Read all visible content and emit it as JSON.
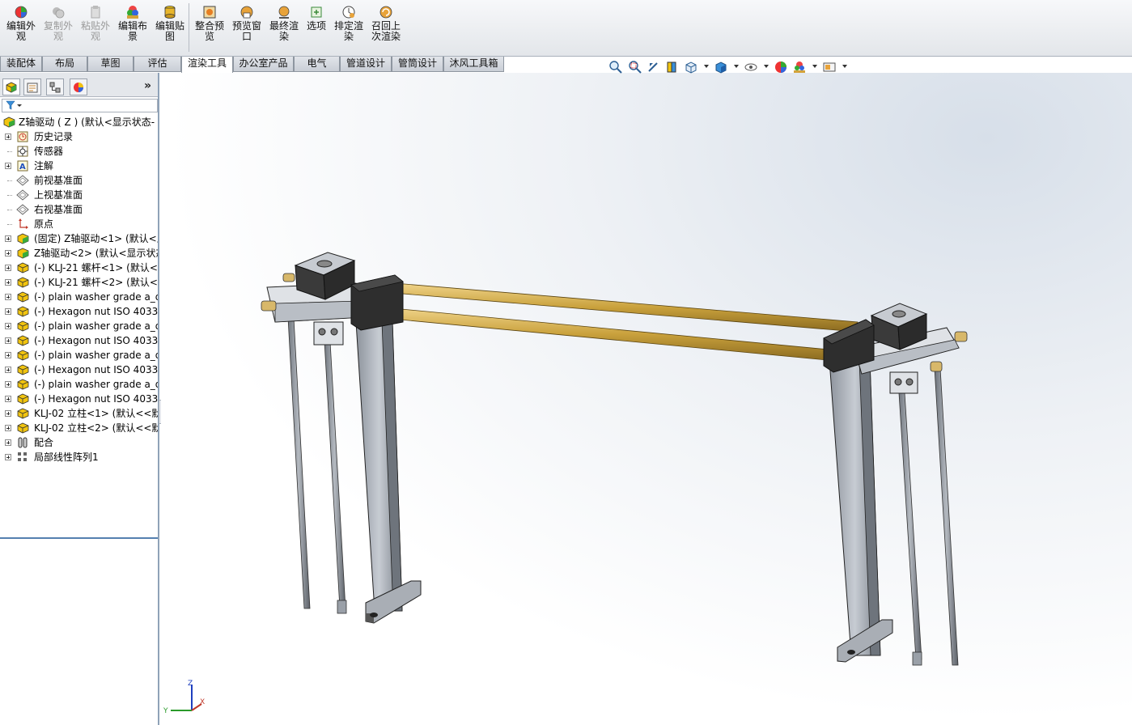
{
  "ribbon": {
    "buttons": [
      {
        "label_line1": "编辑外",
        "label_line2": "观",
        "enabled": true,
        "icon": "edit-appearance-icon"
      },
      {
        "label_line1": "复制外",
        "label_line2": "观",
        "enabled": false,
        "icon": "copy-appearance-icon"
      },
      {
        "label_line1": "粘贴外",
        "label_line2": "观",
        "enabled": false,
        "icon": "paste-appearance-icon"
      },
      {
        "label_line1": "编辑布",
        "label_line2": "景",
        "enabled": true,
        "icon": "edit-scene-icon"
      },
      {
        "label_line1": "编辑贴",
        "label_line2": "图",
        "enabled": true,
        "icon": "edit-decal-icon"
      },
      {
        "label_line1": "整合预",
        "label_line2": "览",
        "enabled": true,
        "icon": "integrated-preview-icon"
      },
      {
        "label_line1": "预览窗",
        "label_line2": "口",
        "enabled": true,
        "icon": "preview-window-icon"
      },
      {
        "label_line1": "最终渲",
        "label_line2": "染",
        "enabled": true,
        "icon": "final-render-icon"
      },
      {
        "label_line1": "选项",
        "label_line2": "",
        "enabled": true,
        "icon": "options-icon"
      },
      {
        "label_line1": "排定渲",
        "label_line2": "染",
        "enabled": true,
        "icon": "schedule-render-icon"
      },
      {
        "label_line1": "召回上",
        "label_line2": "次渲染",
        "enabled": true,
        "icon": "recall-render-icon"
      }
    ]
  },
  "tabs": [
    "装配体",
    "布局",
    "草图",
    "评估",
    "渲染工具",
    "办公室产品",
    "电气",
    "管道设计",
    "管筒设计",
    "沐风工具箱"
  ],
  "active_tab": "渲染工具",
  "panel": {
    "expand_label": "»"
  },
  "tree": {
    "root": "Z轴驱动 ( Z )   (默认<显示状态-",
    "items": [
      {
        "label": "历史记录",
        "icon": "history-icon",
        "expandable": true
      },
      {
        "label": "传感器",
        "icon": "sensor-icon",
        "expandable": false
      },
      {
        "label": "注解",
        "icon": "annotation-icon",
        "expandable": true
      },
      {
        "label": "前视基准面",
        "icon": "plane-icon",
        "expandable": false
      },
      {
        "label": "上视基准面",
        "icon": "plane-icon",
        "expandable": false
      },
      {
        "label": "右视基准面",
        "icon": "plane-icon",
        "expandable": false
      },
      {
        "label": "原点",
        "icon": "origin-icon",
        "expandable": false
      },
      {
        "label": "(固定) Z轴驱动<1> (默认<显",
        "icon": "subassembly-icon",
        "expandable": true
      },
      {
        "label": "Z轴驱动<2> (默认<显示状态",
        "icon": "subassembly-icon",
        "expandable": true
      },
      {
        "label": "(-) KLJ-21 螺杆<1> (默认<<",
        "icon": "part-icon",
        "expandable": true
      },
      {
        "label": "(-) KLJ-21 螺杆<2> (默认<<",
        "icon": "part-icon",
        "expandable": true
      },
      {
        "label": "(-) plain washer grade a_d",
        "icon": "part-icon",
        "expandable": true
      },
      {
        "label": "(-) Hexagon nut ISO 4033",
        "icon": "part-icon",
        "expandable": true
      },
      {
        "label": "(-) plain washer grade a_d",
        "icon": "part-icon",
        "expandable": true
      },
      {
        "label": "(-) Hexagon nut ISO 4033",
        "icon": "part-icon",
        "expandable": true
      },
      {
        "label": "(-) plain washer grade a_d",
        "icon": "part-icon",
        "expandable": true
      },
      {
        "label": "(-) Hexagon nut ISO 4033",
        "icon": "part-icon",
        "expandable": true
      },
      {
        "label": "(-) plain washer grade a_d",
        "icon": "part-icon",
        "expandable": true
      },
      {
        "label": "(-) Hexagon nut ISO 4033",
        "icon": "part-icon",
        "expandable": true
      },
      {
        "label": "KLJ-02 立柱<1> (默认<<默",
        "icon": "part-icon",
        "expandable": true
      },
      {
        "label": "KLJ-02 立柱<2> (默认<<默",
        "icon": "part-icon",
        "expandable": true
      },
      {
        "label": "配合",
        "icon": "mates-icon",
        "expandable": true
      },
      {
        "label": "局部线性阵列1",
        "icon": "linear-pattern-icon",
        "expandable": true
      }
    ]
  },
  "triad": {
    "x": "X",
    "y": "Y",
    "z": "Z"
  },
  "colors": {
    "rod": "#c9a13c",
    "metal": "#b9bec7",
    "dark": "#2b2b2b",
    "motor": "#3a3a3a"
  }
}
